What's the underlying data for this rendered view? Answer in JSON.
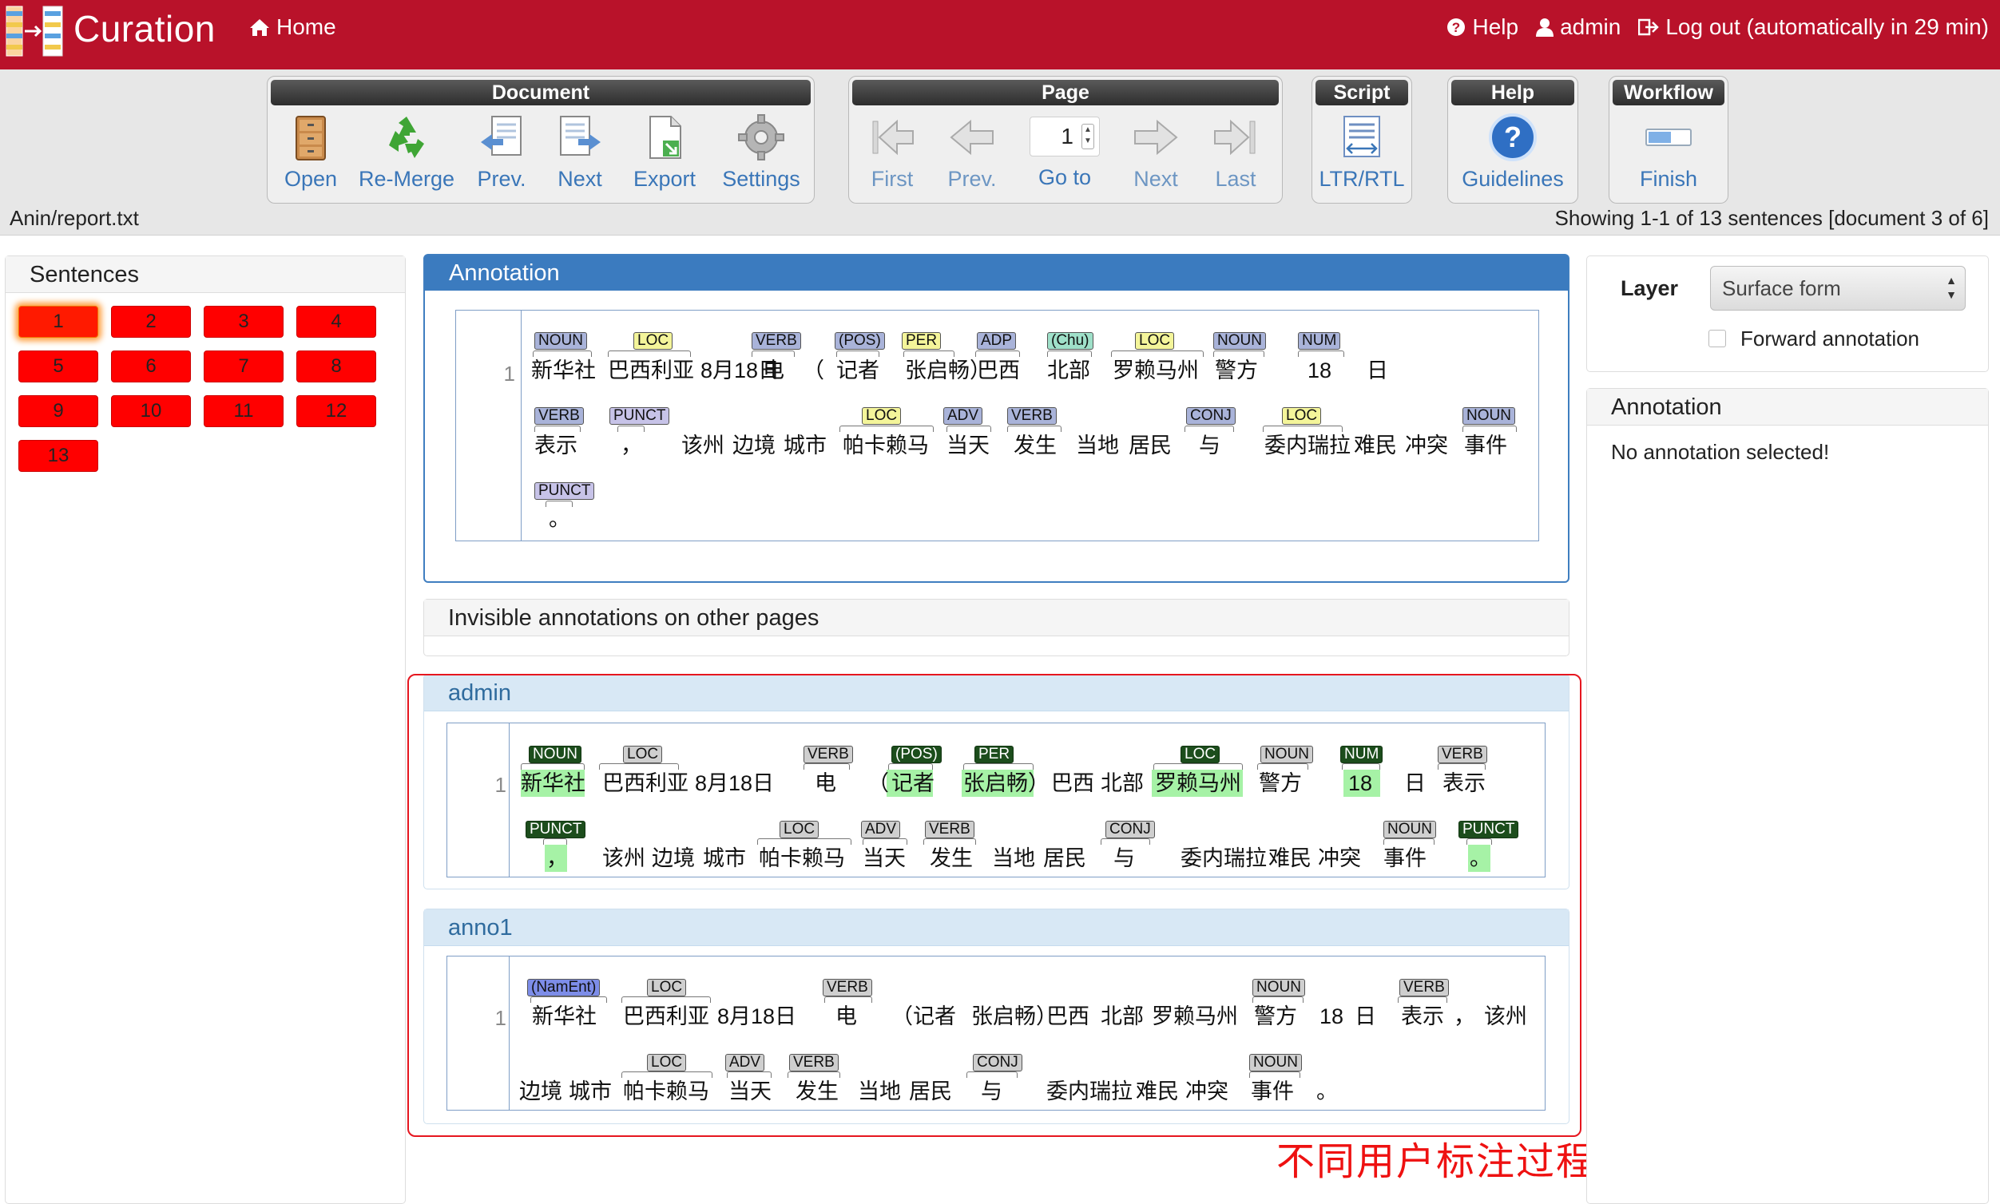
{
  "navbar": {
    "title": "Curation",
    "home": "Home",
    "help": "Help",
    "user": "admin",
    "logout": "Log out (automatically in 29 min)"
  },
  "toolbar": {
    "document": {
      "title": "Document",
      "buttons": [
        {
          "label": "Open",
          "icon": "cabinet-icon"
        },
        {
          "label": "Re-Merge",
          "icon": "recycle-icon"
        },
        {
          "label": "Prev.",
          "icon": "doc-prev-icon"
        },
        {
          "label": "Next",
          "icon": "doc-next-icon"
        },
        {
          "label": "Export",
          "icon": "export-icon"
        },
        {
          "label": "Settings",
          "icon": "gear-icon"
        }
      ]
    },
    "page": {
      "title": "Page",
      "buttons": [
        {
          "label": "First",
          "icon": "first-page-icon"
        },
        {
          "label": "Prev.",
          "icon": "prev-page-icon"
        },
        {
          "label": "Go to",
          "icon": "page-input"
        },
        {
          "label": "Next",
          "icon": "next-page-icon"
        },
        {
          "label": "Last",
          "icon": "last-page-icon"
        }
      ],
      "current_page": "1"
    },
    "script": {
      "title": "Script",
      "button": "LTR/RTL"
    },
    "help": {
      "title": "Help",
      "button": "Guidelines"
    },
    "workflow": {
      "title": "Workflow",
      "button": "Finish"
    }
  },
  "doc_path": "Anin/report.txt",
  "doc_status": "Showing 1-1 of 13 sentences [document 3 of 6]",
  "sentences": {
    "title": "Sentences",
    "items": [
      "1",
      "2",
      "3",
      "4",
      "5",
      "6",
      "7",
      "8",
      "9",
      "10",
      "11",
      "12",
      "13"
    ],
    "active": "1"
  },
  "annotation_panel": {
    "title": "Annotation",
    "line_no": "1",
    "row1_tokens": [
      "新华社",
      "巴西利亚",
      "8月18日",
      "电",
      "（",
      "记者",
      "张启畅）",
      "巴西",
      "北部",
      "罗赖马州",
      "警方",
      "18",
      "日"
    ],
    "row1_tags": [
      "NOUN",
      "LOC",
      "VERB",
      "(POS)",
      "PER",
      "ADP",
      "(Chu)",
      "LOC",
      "NOUN",
      "NUM"
    ],
    "row2_tokens": [
      "表示",
      "，",
      "该州",
      "边境",
      "城市",
      "帕卡赖马",
      "当天",
      "发生",
      "当地",
      "居民",
      "与",
      "委内瑞拉",
      "难民",
      "冲突",
      "事件"
    ],
    "row2_tags": [
      "VERB",
      "PUNCT",
      "LOC",
      "ADV",
      "VERB",
      "CONJ",
      "LOC",
      "NOUN"
    ],
    "row3_tokens": [
      "。"
    ],
    "row3_tags": [
      "PUNCT"
    ]
  },
  "invisible_panel": {
    "title": "Invisible annotations on other pages"
  },
  "admin_panel": {
    "title": "admin",
    "line_no": "1",
    "row1_tokens": [
      "新华社",
      "巴西利亚",
      "8月18日",
      "电",
      "（",
      "记者",
      "张启畅）",
      "巴西",
      "北部",
      "罗赖马州",
      "警方",
      "18",
      "日",
      "表示"
    ],
    "row1_tags": [
      "NOUN",
      "LOC",
      "VERB",
      "(POS)",
      "PER",
      "LOC",
      "NOUN",
      "NUM",
      "VERB"
    ],
    "row2_tokens": [
      "，",
      "该州",
      "边境",
      "城市",
      "帕卡赖马",
      "当天",
      "发生",
      "当地",
      "居民",
      "与",
      "委内瑞拉",
      "难民",
      "冲突",
      "事件",
      "。"
    ],
    "row2_tags": [
      "PUNCT",
      "LOC",
      "ADV",
      "VERB",
      "CONJ",
      "NOUN",
      "PUNCT"
    ]
  },
  "anno1_panel": {
    "title": "anno1",
    "line_no": "1",
    "row1_tokens": [
      "新华社",
      "巴西利亚",
      "8月18日",
      "电",
      "（记者",
      "张启畅）",
      "巴西",
      "北部",
      "罗赖马州",
      "警方",
      "18",
      "日",
      "表示",
      "，",
      "该州"
    ],
    "row1_tags": [
      "(NamEnt)",
      "LOC",
      "VERB",
      "NOUN",
      "VERB"
    ],
    "row2_tokens": [
      "边境",
      "城市",
      "帕卡赖马",
      "当天",
      "发生",
      "当地",
      "居民",
      "与",
      "委内瑞拉",
      "难民",
      "冲突",
      "事件",
      "。"
    ],
    "row2_tags": [
      "LOC",
      "ADV",
      "VERB",
      "CONJ",
      "NOUN"
    ]
  },
  "caption": "不同用户标注过程的对比",
  "layer_panel": {
    "label": "Layer",
    "selected": "Surface form",
    "forward": "Forward annotation"
  },
  "annotation_side": {
    "title": "Annotation",
    "message": "No annotation selected!"
  },
  "colors": {
    "navbar": "#b9122a",
    "accent_blue": "#3b7bbf",
    "sentence_red": "#ff0000",
    "highlight_green": "#a6f2a6",
    "caption_red": "#ee1111"
  }
}
